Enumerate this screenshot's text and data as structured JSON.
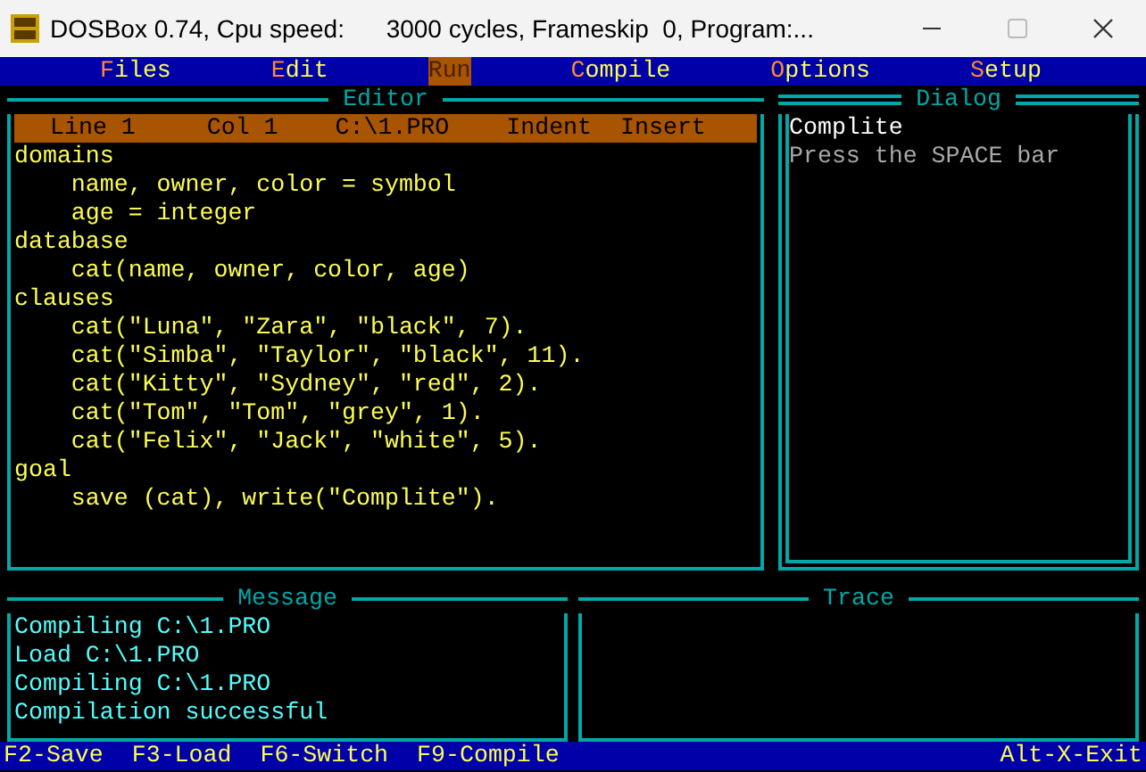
{
  "window": {
    "title": "DOSBox 0.74, Cpu speed:      3000 cycles, Frameskip  0, Program:..."
  },
  "menu": [
    {
      "label": "Files",
      "selected": false
    },
    {
      "label": "Edit",
      "selected": false
    },
    {
      "label": "Run",
      "selected": true
    },
    {
      "label": "Compile",
      "selected": false
    },
    {
      "label": "Options",
      "selected": false
    },
    {
      "label": "Setup",
      "selected": false
    }
  ],
  "editor": {
    "title": "Editor",
    "status": [
      "Line 1",
      "Col 1",
      "C:\\1.PRO",
      "Indent",
      "Insert"
    ],
    "lines": [
      "domains",
      "    name, owner, color = symbol",
      "    age = integer",
      "database",
      "    cat(name, owner, color, age)",
      "clauses",
      "    cat(\"Luna\", \"Zara\", \"black\", 7).",
      "    cat(\"Simba\", \"Taylor\", \"black\", 11).",
      "    cat(\"Kitty\", \"Sydney\", \"red\", 2).",
      "    cat(\"Tom\", \"Tom\", \"grey\", 1).",
      "    cat(\"Felix\", \"Jack\", \"white\", 5).",
      "goal",
      "    save (cat), write(\"Complite\")."
    ]
  },
  "dialog": {
    "title": "Dialog",
    "heading": "Complite",
    "prompt": "Press the SPACE bar"
  },
  "message": {
    "title": "Message",
    "lines": [
      "Compiling C:\\1.PRO",
      "Load C:\\1.PRO",
      "Compiling C:\\1.PRO",
      "Compilation successful"
    ]
  },
  "trace": {
    "title": "Trace"
  },
  "status_bar": {
    "keys": [
      "F2-Save",
      "F3-Load",
      "F6-Switch",
      "F9-Compile"
    ],
    "exit": "Alt-X-Exit"
  }
}
